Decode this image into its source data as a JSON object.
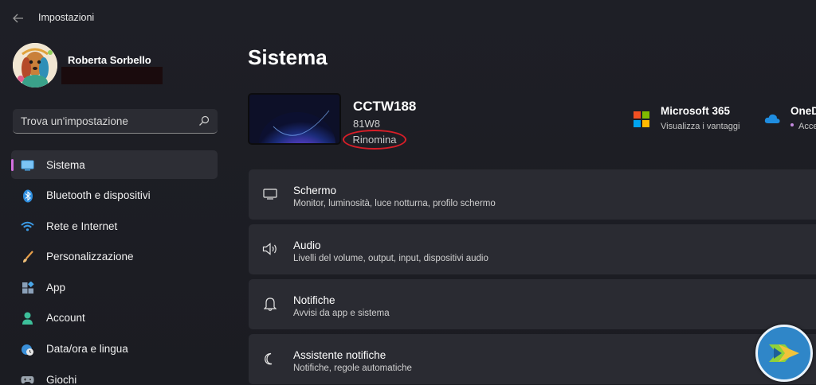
{
  "window": {
    "title": "Impostazioni"
  },
  "profile": {
    "name": "Roberta Sorbello"
  },
  "search": {
    "placeholder": "Trova un'impostazione"
  },
  "sidebar": {
    "items": [
      {
        "label": "Sistema",
        "icon": "monitor-icon",
        "active": true
      },
      {
        "label": "Bluetooth e dispositivi",
        "icon": "bluetooth-icon"
      },
      {
        "label": "Rete e Internet",
        "icon": "wifi-icon"
      },
      {
        "label": "Personalizzazione",
        "icon": "brush-icon"
      },
      {
        "label": "App",
        "icon": "apps-icon"
      },
      {
        "label": "Account",
        "icon": "person-icon"
      },
      {
        "label": "Data/ora e lingua",
        "icon": "globe-clock-icon"
      },
      {
        "label": "Giochi",
        "icon": "gamepad-icon"
      }
    ],
    "accent": "#d46fe0"
  },
  "main": {
    "title": "Sistema",
    "device": {
      "name": "CCTW188",
      "model": "81W8",
      "rename_label": "Rinomina"
    },
    "promos": [
      {
        "title": "Microsoft 365",
        "subtitle": "Visualizza i vantaggi",
        "icon": "microsoft-logo-icon"
      },
      {
        "title": "OneD",
        "subtitle": "Acce",
        "icon": "onedrive-cloud-icon"
      }
    ],
    "cards": [
      {
        "title": "Schermo",
        "subtitle": "Monitor, luminosità, luce notturna, profilo schermo",
        "icon": "display-icon"
      },
      {
        "title": "Audio",
        "subtitle": "Livelli del volume, output, input, dispositivi audio",
        "icon": "speaker-icon"
      },
      {
        "title": "Notifiche",
        "subtitle": "Avvisi da app e sistema",
        "icon": "bell-icon"
      },
      {
        "title": "Assistente notifiche",
        "subtitle": "Notifiche, regole automatiche",
        "icon": "moon-icon"
      }
    ]
  },
  "colors": {
    "background": "#1c1d24",
    "card": "#2a2b32",
    "annotation_circle": "#d81e28"
  }
}
